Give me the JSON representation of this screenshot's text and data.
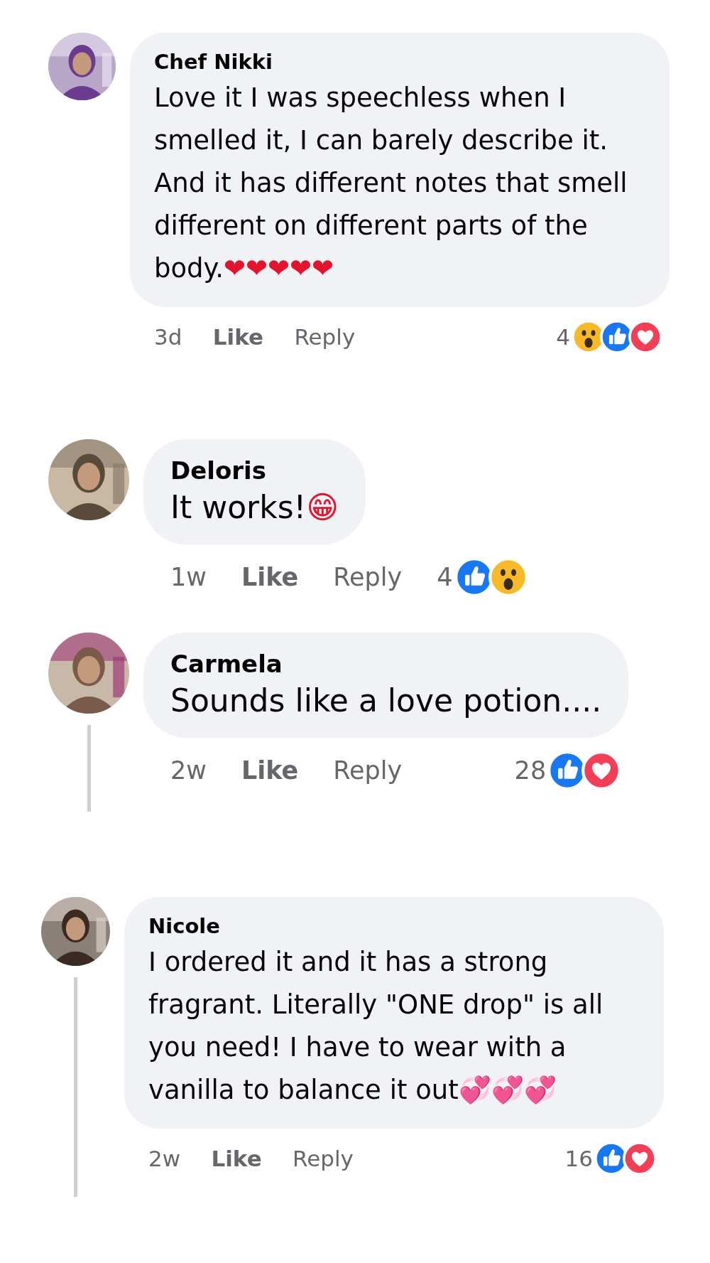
{
  "comments": [
    {
      "author": "Chef Nikki",
      "text": "Love it I was speechless when I smelled it, I can barely describe it. And it has different notes that smell different on different parts of the body.",
      "emoji": "❤❤❤❤❤",
      "time": "3d",
      "like_label": "Like",
      "reply_label": "Reply",
      "reaction_count": "4",
      "reactions": [
        {
          "kind": "wow"
        },
        {
          "kind": "like"
        },
        {
          "kind": "love"
        }
      ]
    },
    {
      "author": "Deloris",
      "text": "It works!",
      "emoji": "😁",
      "time": "1w",
      "like_label": "Like",
      "reply_label": "Reply",
      "reaction_count": "4",
      "reactions": [
        {
          "kind": "like"
        },
        {
          "kind": "wow"
        }
      ]
    },
    {
      "author": "Carmela",
      "text": "Sounds like a love potion....",
      "time": "2w",
      "like_label": "Like",
      "reply_label": "Reply",
      "reaction_count": "28",
      "reactions": [
        {
          "kind": "like"
        },
        {
          "kind": "love"
        }
      ]
    },
    {
      "author": "Nicole",
      "text": "I ordered it and it has a strong fragrant. Literally \"ONE drop\" is all you need! I have to wear with a vanilla to balance it out",
      "emoji": "💞💞💞",
      "time": "2w",
      "like_label": "Like",
      "reply_label": "Reply",
      "reaction_count": "16",
      "reactions": [
        {
          "kind": "like"
        },
        {
          "kind": "love"
        }
      ]
    }
  ]
}
